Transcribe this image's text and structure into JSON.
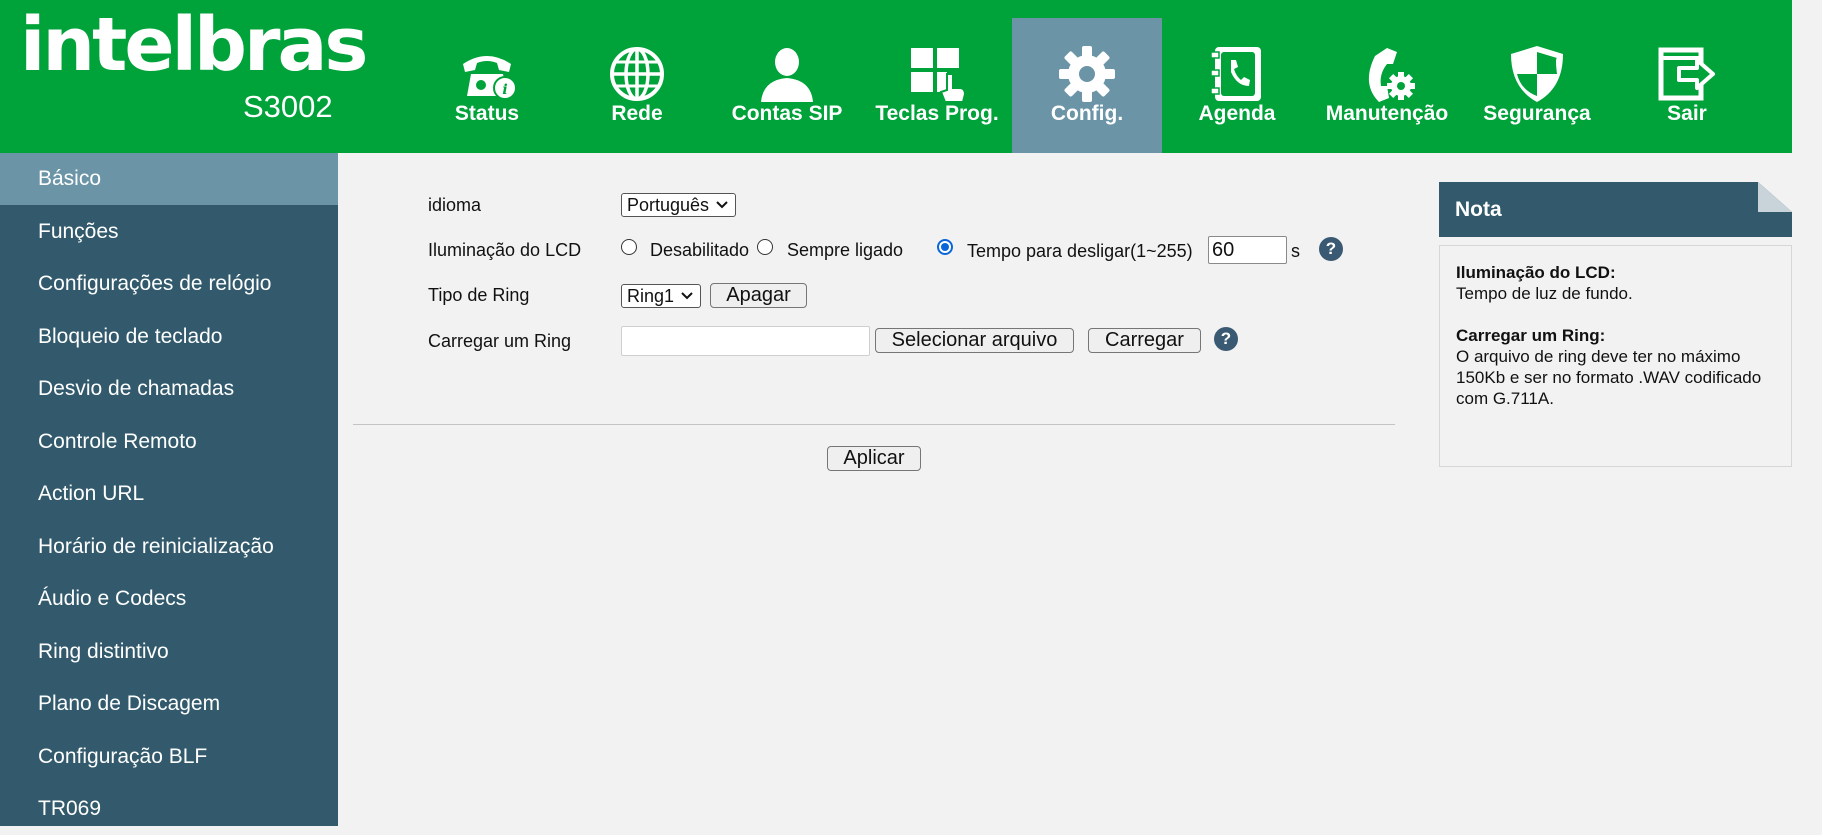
{
  "brand": {
    "logo_text": "intelbras",
    "model": "S3002"
  },
  "colors": {
    "header_green": "#00a23a",
    "sidebar_blue": "#325a6c",
    "active_item": "#6b94a7",
    "radio_blue": "#0a66d8"
  },
  "nav": {
    "items": [
      {
        "label": "Status",
        "icon": "telephone-info-icon"
      },
      {
        "label": "Rede",
        "icon": "globe-icon"
      },
      {
        "label": "Contas SIP",
        "icon": "user-icon"
      },
      {
        "label": "Teclas Prog.",
        "icon": "keypad-hand-icon"
      },
      {
        "label": "Config.",
        "icon": "gear-icon",
        "active": true
      },
      {
        "label": "Agenda",
        "icon": "phonebook-icon"
      },
      {
        "label": "Manutenção",
        "icon": "phone-gear-icon"
      },
      {
        "label": "Segurança",
        "icon": "shield-icon"
      },
      {
        "label": "Sair",
        "icon": "logout-icon"
      }
    ]
  },
  "sidebar": {
    "items": [
      {
        "label": "Básico",
        "active": true
      },
      {
        "label": "Funções"
      },
      {
        "label": "Configurações de relógio"
      },
      {
        "label": "Bloqueio de teclado"
      },
      {
        "label": "Desvio de chamadas"
      },
      {
        "label": "Controle Remoto"
      },
      {
        "label": "Action URL"
      },
      {
        "label": "Horário de reinicialização"
      },
      {
        "label": "Áudio e Codecs"
      },
      {
        "label": "Ring distintivo"
      },
      {
        "label": "Plano de Discagem"
      },
      {
        "label": "Configuração BLF"
      },
      {
        "label": "TR069"
      }
    ]
  },
  "form": {
    "idioma": {
      "label": "idioma",
      "value": "Português"
    },
    "lcd": {
      "label": "Iluminação do LCD",
      "options": [
        "Desabilitado",
        "Sempre ligado",
        "Tempo para desligar(1~255)"
      ],
      "selected": "Tempo para desligar(1~255)",
      "value": "60",
      "unit": "s"
    },
    "ring": {
      "label": "Tipo de Ring",
      "value": "Ring1",
      "delete_label": "Apagar"
    },
    "upload": {
      "label": "Carregar um Ring",
      "file_value": "",
      "select_label": "Selecionar arquivo",
      "upload_label": "Carregar"
    },
    "help_glyph": "?",
    "apply_label": "Aplicar"
  },
  "note": {
    "title": "Nota",
    "sections": [
      {
        "heading": "Iluminação do LCD:",
        "text": "Tempo de luz de fundo."
      },
      {
        "heading": "Carregar um Ring:",
        "text": "O arquivo de ring deve ter no máximo 150Kb e ser no formato .WAV codificado com G.711A."
      }
    ]
  }
}
